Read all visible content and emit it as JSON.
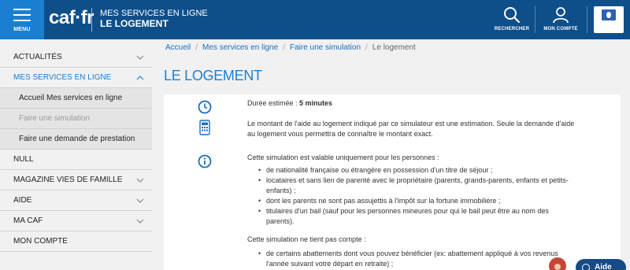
{
  "header": {
    "menu_label": "MENU",
    "logo": "caf·fr",
    "site_line1": "MES SERVICES EN LIGNE",
    "site_line2": "LE LOGEMENT",
    "search_label": "RECHERCHER",
    "account_label": "MON COMPTE",
    "brand_color": "#0e4f8a",
    "accent_color": "#1a7fd0"
  },
  "sidebar": {
    "items": [
      {
        "label": "ACTUALITÉS",
        "chevron": "down"
      },
      {
        "label": "MES SERVICES EN LIGNE",
        "chevron": "up",
        "active": true
      },
      {
        "label": "NULL"
      },
      {
        "label": "MAGAZINE VIES DE FAMILLE",
        "chevron": "down"
      },
      {
        "label": "AIDE",
        "chevron": "down"
      },
      {
        "label": "MA CAF",
        "chevron": "down"
      },
      {
        "label": "MON COMPTE"
      }
    ],
    "subitems": [
      {
        "label": "Accueil Mes services en ligne"
      },
      {
        "label": "Faire une simulation",
        "disabled": true
      },
      {
        "label": "Faire une demande de prestation"
      }
    ]
  },
  "breadcrumb": {
    "items": [
      "Accueil",
      "Mes services en ligne",
      "Faire une simulation"
    ],
    "current": "Le logement"
  },
  "main": {
    "title": "LE LOGEMENT",
    "duration_label": "Durée estimée :",
    "duration_value": "5 minutes",
    "estimate_line1": "Le montant de l'aide au logement indiqué par ce simulateur est une estimation. Seule la demande d'aide",
    "estimate_line2": "au logement vous permettra de connaître le montant exact.",
    "valid_intro": "Cette simulation est valable uniquement pour les personnes :",
    "valid_items": [
      "de nationalité française ou étrangère en possession d'un titre de séjour ;",
      "locataires et sans lien de parenté avec le propriétaire (parents, grands-parents, enfants et petits-",
      "enfants) ;",
      "dont les parents ne sont pas assujettis à l'impôt sur la fortune immobilière ;",
      "titulaires d'un bail (sauf pour les personnes mineures pour qui le bail peut être au nom des",
      "parents)."
    ],
    "notcount_intro": "Cette simulation ne tient pas compte :",
    "notcount_items": [
      "de certains abattements dont vous pouvez bénéficier (ex: abattement appliqué à vos revenus",
      "l'année suivant votre départ en retraite) ;"
    ]
  },
  "help": {
    "label": "Aide"
  }
}
